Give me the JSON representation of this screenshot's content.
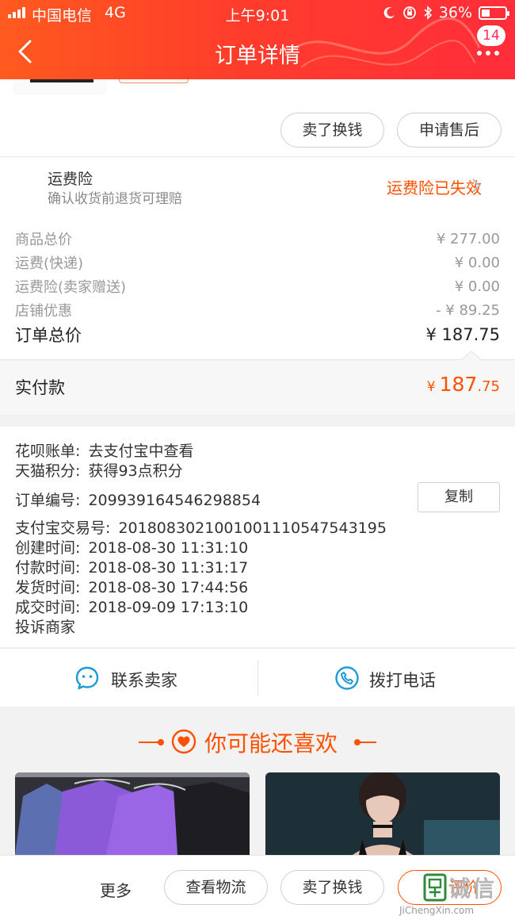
{
  "status_bar": {
    "carrier": "中国电信",
    "network": "4G",
    "time": "上午9:01",
    "battery": "36%"
  },
  "nav": {
    "title": "订单详情",
    "badge": "14"
  },
  "order_actions": {
    "sell_label": "卖了换钱",
    "after_sale_label": "申请售后"
  },
  "insurance": {
    "title": "运费险",
    "desc": "确认收货前退货可理赔",
    "status": "运费险已失效"
  },
  "price_summary": {
    "rows": [
      {
        "label": "商品总价",
        "amount": "¥ 277.00"
      },
      {
        "label": "运费(快递)",
        "amount": "¥ 0.00"
      },
      {
        "label": "运费险(卖家赠送)",
        "amount": "¥ 0.00"
      },
      {
        "label": "店铺优惠",
        "amount": "- ¥ 89.25"
      }
    ],
    "total_label": "订单总价",
    "total_amount": "¥ 187.75"
  },
  "payment": {
    "label": "实付款",
    "currency": "¥",
    "integer": "187",
    "decimal": ".75"
  },
  "order_info": {
    "huabei_label": "花呗账单:",
    "huabei_value": "去支付宝中查看",
    "points_label": "天猫积分:",
    "points_value": "获得93点积分",
    "order_no_label": "订单编号:",
    "order_no": "2099391645462988​54",
    "copy_label": "复制",
    "alipay_label": "支付宝交易号:",
    "alipay_no": "2018083021001001110547543195",
    "created_label": "创建时间:",
    "created": "2018-08-30 11:31:10",
    "paid_label": "付款时间:",
    "paid": "2018-08-30 11:31:17",
    "shipped_label": "发货时间:",
    "shipped": "2018-08-30 17:44:56",
    "closed_label": "成交时间:",
    "closed": "2018-09-09 17:13:10",
    "complain_label": "投诉商家"
  },
  "contact": {
    "seller_label": "联系卖家",
    "phone_label": "拨打电话"
  },
  "recommend": {
    "title": "你可能还喜欢"
  },
  "bottom_bar": {
    "more_label": "更多",
    "logistics_label": "查看物流",
    "sell_label": "卖了换钱",
    "review_label": "评价"
  },
  "watermark": {
    "text": "诚信",
    "url": "JiChengXin.com"
  },
  "colors": {
    "accent": "#ff5000",
    "header": "#ff3d2b",
    "contact_icon": "#1d9bd6"
  }
}
